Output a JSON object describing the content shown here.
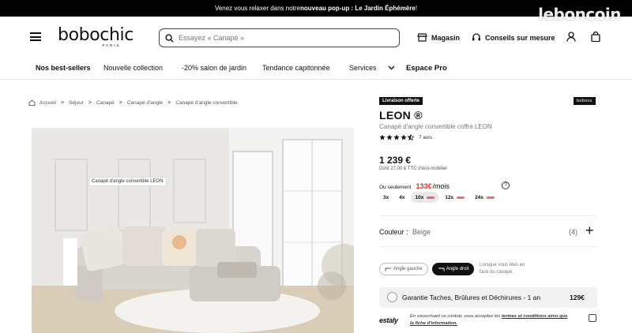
{
  "banner": {
    "text_before": "Venez vous relaxer dans notre ",
    "text_bold": "nouveau pop-up : Le Jardin Éphémère",
    "text_after": " !"
  },
  "watermark": "leboncoin",
  "header": {
    "logo_name": "bobochic",
    "logo_sub": "PARIS",
    "search_placeholder": "Essayez « Canapé »",
    "store_label": "Magasin",
    "custom_label": "Conseils sur mesure"
  },
  "nav": {
    "items": [
      "Nos best-sellers",
      "Nouvelle collection",
      "-20% salon de jardin",
      "Tendance capitonnée",
      "Services",
      "Espace Pro"
    ]
  },
  "breadcrumb": [
    "Accueil",
    "Séjour",
    "Canapé",
    "Canapé d'angle",
    "Canapé d'angle convertible"
  ],
  "photo": {
    "tag": "Canapé d'angle convertible LEON"
  },
  "product": {
    "badge": "Livraison offerte",
    "brand_tag": "boboxs",
    "title": "LEON ®",
    "subtitle": "Canapé d'angle convertible coffre LEON",
    "rating": 4.5,
    "reviews": "7 avis",
    "price": "1 239 €",
    "ecotax": "Dont 27,00 € TTC d'éco-mobilier",
    "instal_label": "Ou seulement",
    "instal_amount": "133€",
    "instal_period": "/mois",
    "help": "?",
    "plans": [
      {
        "label": "3x",
        "selected": false,
        "logo": false
      },
      {
        "label": "4x",
        "selected": false,
        "logo": false
      },
      {
        "label": "10x",
        "selected": true,
        "logo": true
      },
      {
        "label": "12x",
        "selected": false,
        "logo": true
      },
      {
        "label": "24x",
        "selected": false,
        "logo": true
      }
    ],
    "color_label": "Couleur :",
    "color_value": "Beige",
    "color_count": "(4)",
    "plus": "+",
    "orient_left": "Angle gauche",
    "orient_right": "Angle droit",
    "orient_note": "Lorsque vous êtes en face du canapé.",
    "warranty_text": "Garantie Taches, Brûlures et Déchirures - 1 an",
    "warranty_price": "129€",
    "estaly": "estaly",
    "legal_before": "En souscrivant ce contrat, vous acceptez les ",
    "legal_link1": "termes et conditions ainsi que",
    "legal_link2": "la fiche d'information."
  },
  "colors": {
    "accent_red": "#e2332f",
    "black": "#111111"
  }
}
